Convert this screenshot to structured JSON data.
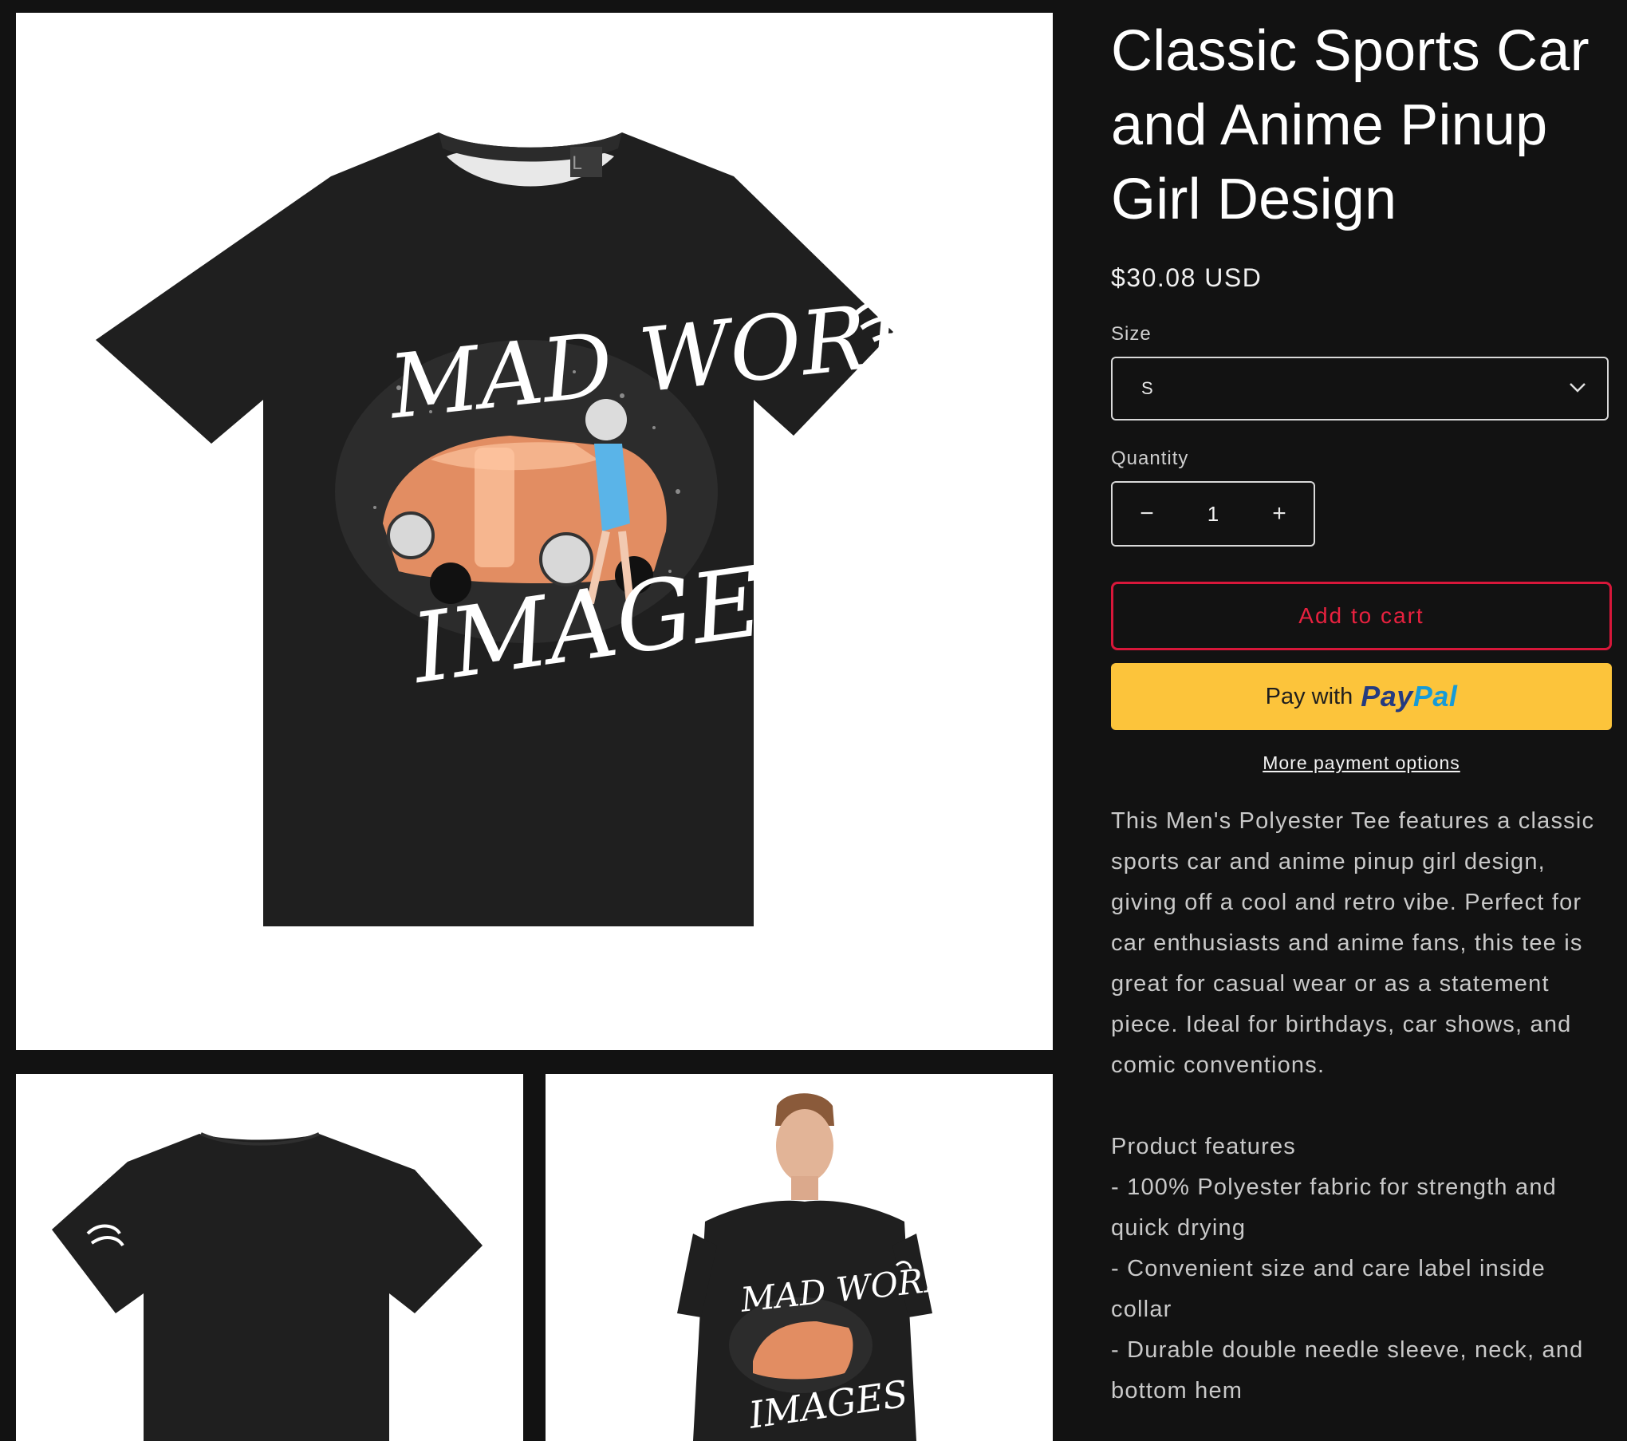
{
  "product": {
    "title": "Classic Sports Car and Anime Pinup Girl Design",
    "price": "$30.08 USD"
  },
  "size": {
    "label": "Size",
    "selected": "S"
  },
  "quantity": {
    "label": "Quantity",
    "value": "1",
    "decrease_glyph": "−",
    "increase_glyph": "+"
  },
  "actions": {
    "add_to_cart": "Add to cart",
    "paypal_prefix": "Pay with",
    "paypal_brand_a": "Pay",
    "paypal_brand_b": "Pal",
    "more_payment": "More payment options"
  },
  "description": {
    "intro": "This Men's Polyester Tee features a classic sports car and anime pinup girl design, giving off a cool and retro vibe. Perfect for car enthusiasts and anime fans, this tee is great for casual wear or as a statement piece. Ideal for birthdays, car shows, and comic conventions.",
    "features_heading": "Product features",
    "features": [
      "- 100% Polyester fabric for strength and quick drying",
      "- Convenient size and care label inside collar",
      "- Durable double needle sleeve, neck, and bottom hem"
    ]
  },
  "artwork": {
    "line1": "MAD WORLD",
    "line2": "IMAGES",
    "size_tag": "L"
  },
  "colors": {
    "background": "#121212",
    "accent_red": "#d8173a",
    "paypal_yellow": "#fcc43b",
    "shirt": "#1f1f1f"
  }
}
